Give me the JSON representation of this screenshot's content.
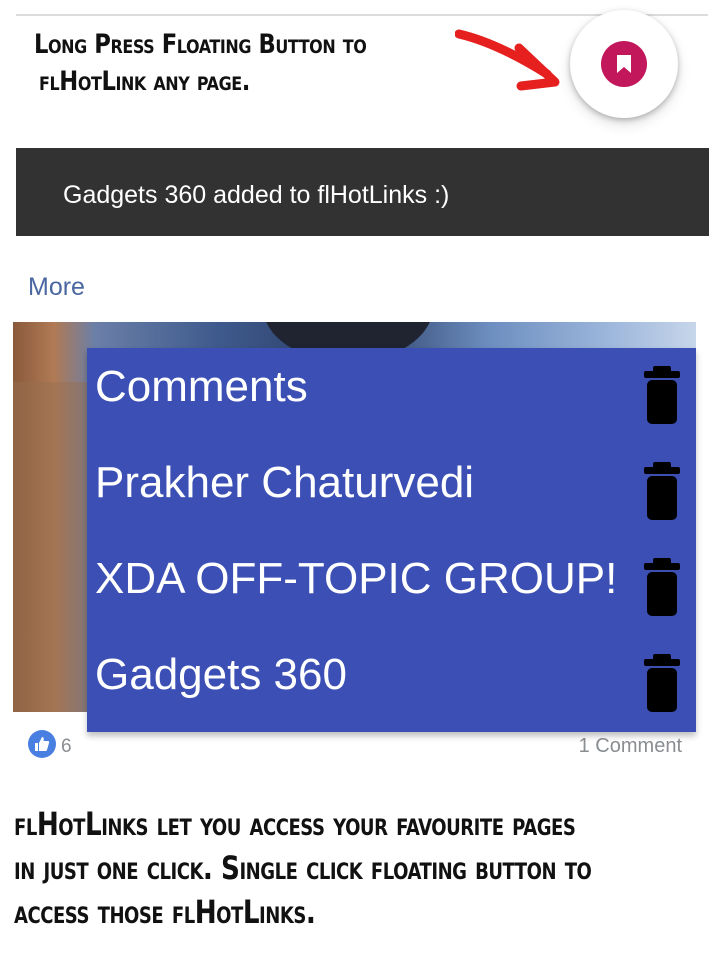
{
  "caption_top": {
    "line1": "Long Press Floating Button to",
    "line2": "flHotLink any page."
  },
  "fab": {
    "icon": "bookmark-icon",
    "color": "#c2185b"
  },
  "snackbar": {
    "message": "Gadgets 360 added to flHotLinks :)"
  },
  "more_link": "More",
  "hotlinks": [
    {
      "label": "Comments",
      "icon": "trash-icon"
    },
    {
      "label": "Prakher Chaturvedi",
      "icon": "trash-icon"
    },
    {
      "label": "XDA OFF-TOPIC GROUP!",
      "icon": "trash-icon"
    },
    {
      "label": "Gadgets 360",
      "icon": "trash-icon"
    }
  ],
  "post_footer": {
    "likes": "6",
    "comments": "1 Comment"
  },
  "caption_bottom": {
    "line1": "flHotLinks let you access your favourite pages",
    "line2": "in just one click. Single click floating button to",
    "line3": "access those flHotLinks."
  },
  "colors": {
    "panel": "#3b4fb5",
    "snackbar": "#323232",
    "accent": "#c2185b",
    "link": "#4b67a1"
  }
}
